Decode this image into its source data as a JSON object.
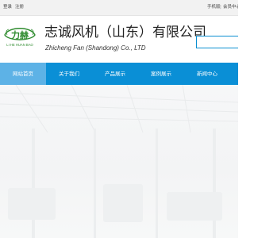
{
  "topbar": {
    "login": "登录",
    "register": "注册",
    "mobile_site": "手机版",
    "separator": "|",
    "member_center": "会员中心"
  },
  "header": {
    "company_name": "志诚风机（山东）有限公司",
    "company_name_en": "Zhicheng Fan (Shandong) Co., LTD",
    "logo": {
      "main_text": "力赫",
      "sub_text": "LI HE HUAN BAO"
    },
    "search": {
      "placeholder": ""
    }
  },
  "nav": {
    "items": [
      {
        "label": "网站首页",
        "active": true
      },
      {
        "label": "关于我们",
        "active": false
      },
      {
        "label": "产品展示",
        "active": false
      },
      {
        "label": "案例展示",
        "active": false
      },
      {
        "label": "新闻中心",
        "active": false
      }
    ]
  },
  "colors": {
    "nav_bg": "#0a8fd6",
    "nav_active_bg": "#5db2e6",
    "logo_green": "#2e8b2e",
    "accent_blue": "#0b8fd1"
  }
}
